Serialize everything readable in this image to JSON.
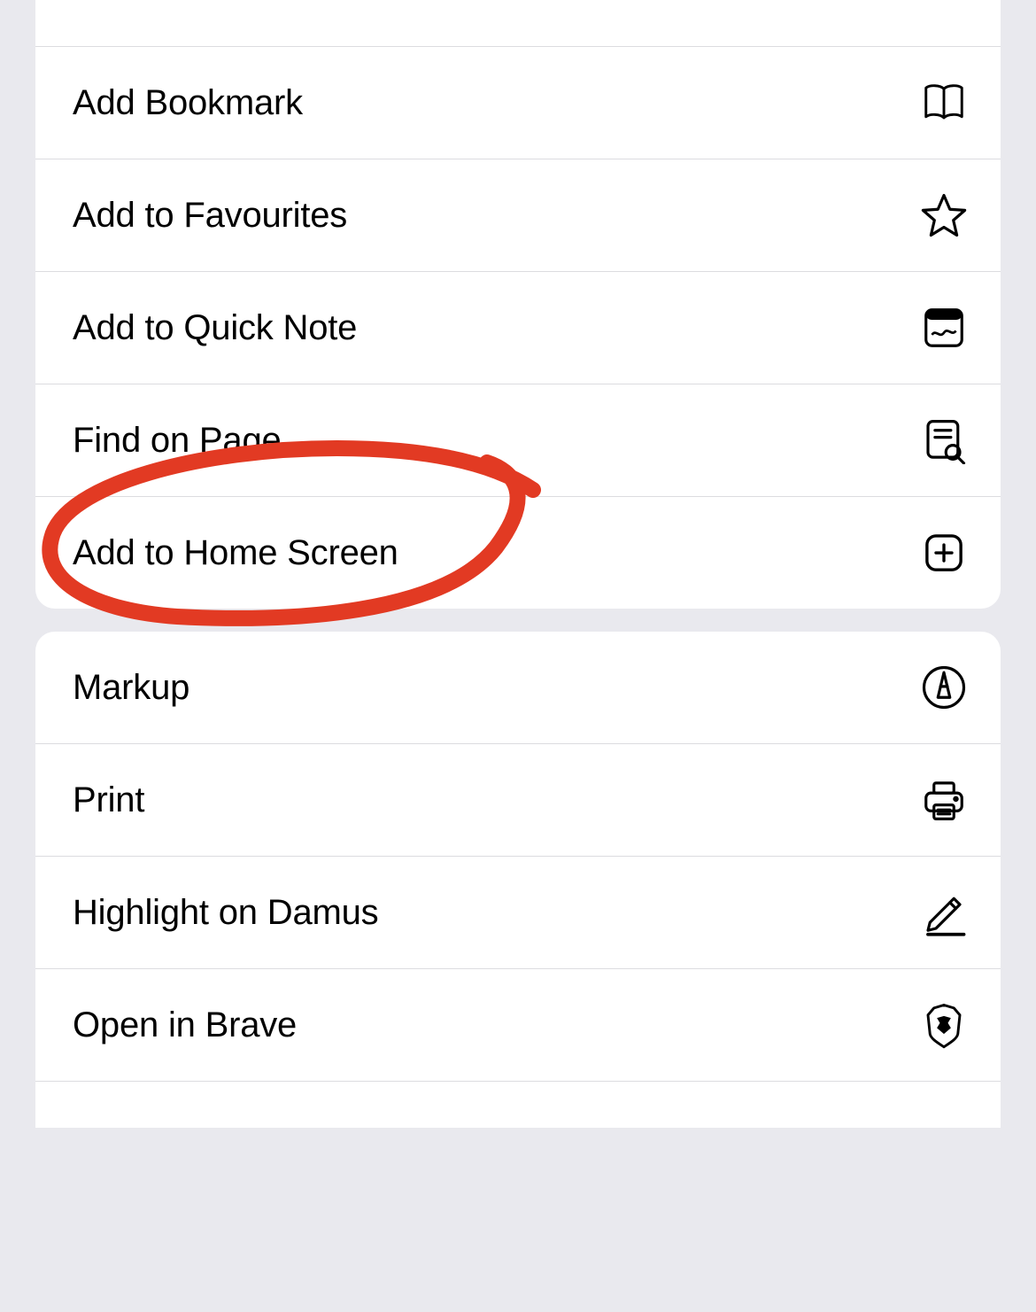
{
  "share_sheet": {
    "group1": {
      "previous_partial": "",
      "add_bookmark": "Add Bookmark",
      "add_to_favourites": "Add to Favourites",
      "add_to_quick_note": "Add to Quick Note",
      "find_on_page": "Find on Page",
      "add_to_home_screen": "Add to Home Screen"
    },
    "group2": {
      "markup": "Markup",
      "print": "Print",
      "highlight_on_damus": "Highlight on Damus",
      "open_in_brave": "Open in Brave"
    }
  },
  "annotation": {
    "circled_item": "Add to Home Screen",
    "color": "#e23a23"
  }
}
